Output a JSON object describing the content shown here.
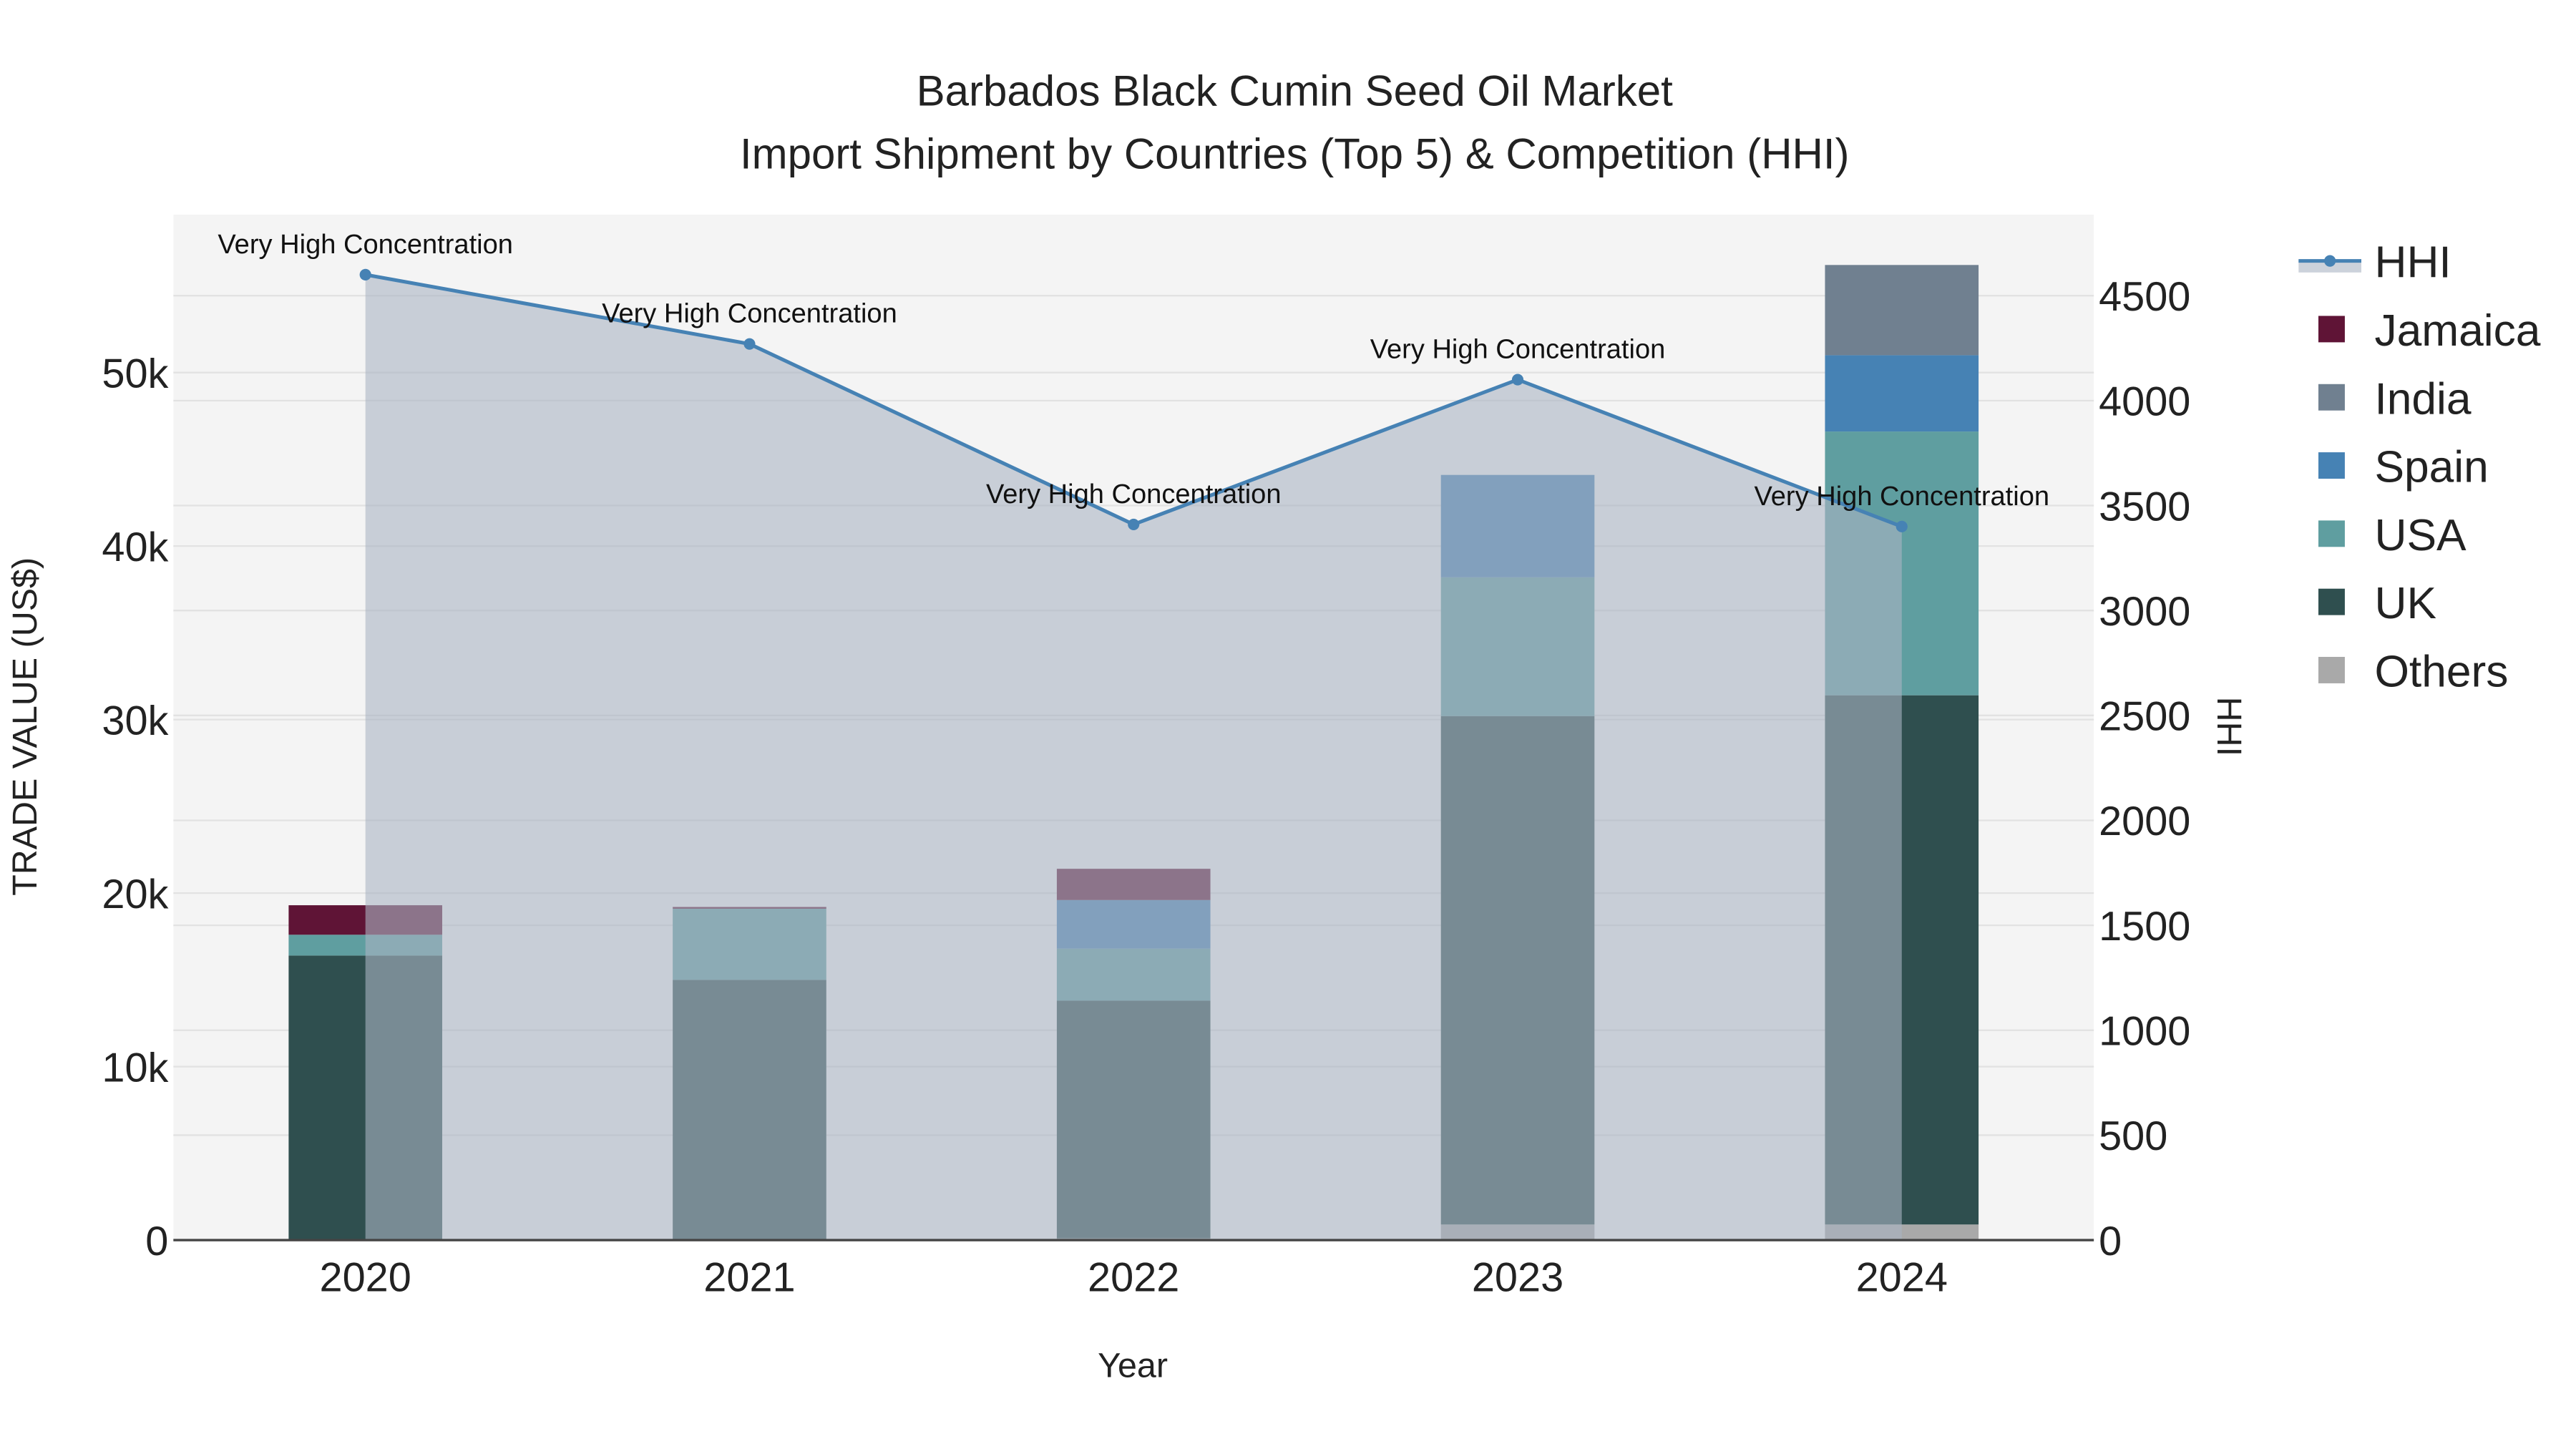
{
  "chart_data": {
    "type": "bar",
    "stacked": true,
    "title": "Barbados Black Cumin Seed Oil Market",
    "subtitle": "Import Shipment by Countries (Top 5) & Competition (HHI)",
    "xlabel": "Year",
    "ylabel": "TRADE VALUE (US$)",
    "y2label": "HHI",
    "categories": [
      "2020",
      "2021",
      "2022",
      "2023",
      "2024"
    ],
    "ylim": [
      0,
      59100
    ],
    "y2lim": [
      0,
      4886
    ],
    "yticks": [
      0,
      10000,
      20000,
      30000,
      40000,
      50000
    ],
    "ytick_labels": [
      "0",
      "10k",
      "20k",
      "30k",
      "40k",
      "50k"
    ],
    "y2ticks": [
      0,
      500,
      1000,
      1500,
      2000,
      2500,
      3000,
      3500,
      4000,
      4500
    ],
    "y2tick_labels": [
      "0",
      "500",
      "1000",
      "1500",
      "2000",
      "2500",
      "3000",
      "3500",
      "4000",
      "4500"
    ],
    "grid": true,
    "legend_placement": "right",
    "series": [
      {
        "name": "Others",
        "color": "#a9a9a9",
        "values": [
          0,
          0,
          100,
          900,
          900
        ]
      },
      {
        "name": "UK",
        "color": "#2f4f4f",
        "values": [
          16400,
          15000,
          13700,
          29300,
          30500
        ]
      },
      {
        "name": "USA",
        "color": "#5f9ea0",
        "values": [
          1200,
          4100,
          3000,
          8000,
          15200
        ]
      },
      {
        "name": "Spain",
        "color": "#4682b4",
        "values": [
          0,
          0,
          2800,
          5900,
          4400
        ]
      },
      {
        "name": "India",
        "color": "#708090",
        "values": [
          0,
          0,
          0,
          0,
          5200
        ]
      },
      {
        "name": "Jamaica",
        "color": "#5f1436",
        "values": [
          1700,
          100,
          1800,
          0,
          0
        ]
      }
    ],
    "hhi": {
      "name": "HHI",
      "color": "#4682b4",
      "values": [
        4600,
        4270,
        3410,
        4100,
        3400
      ],
      "annotations": [
        "Very High Concentration",
        "Very High Concentration",
        "Very High Concentration",
        "Very High Concentration",
        "Very High Concentration"
      ]
    },
    "legend_order": [
      "HHI",
      "Jamaica",
      "India",
      "Spain",
      "USA",
      "UK",
      "Others"
    ]
  }
}
